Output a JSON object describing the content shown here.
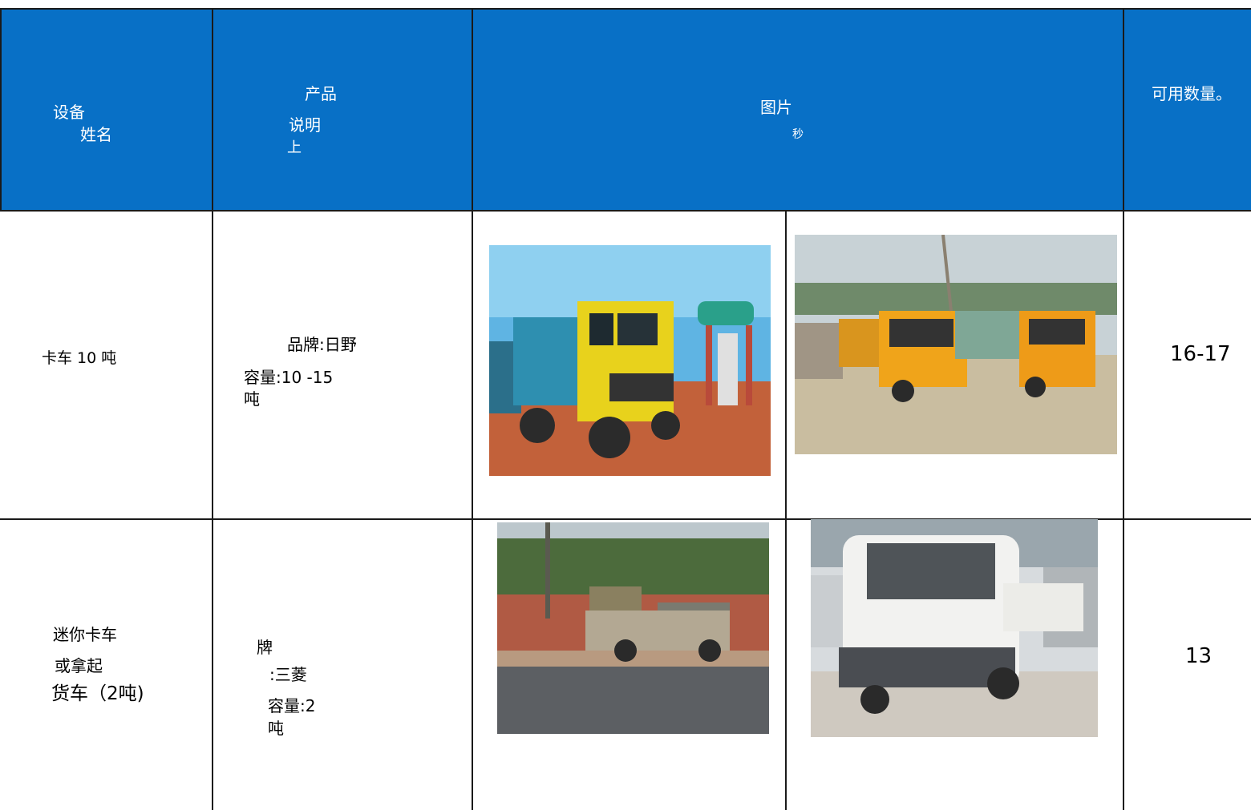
{
  "header": {
    "col1_line1": "设备",
    "col1_line2": "姓名",
    "col2_line1": "产品",
    "col2_line2": "说明",
    "col2_line3": "上",
    "col3_line1": "图片",
    "col3_line2": "秒",
    "col4": "可用数量。"
  },
  "rows": [
    {
      "name": "卡车 10 吨",
      "desc_line1": "品牌:日野",
      "desc_line2": "容量:10 -15",
      "desc_line3": "吨",
      "qty": "16-17",
      "photo1_icon": "yellow-truck-photo",
      "photo2_icon": "orange-trucks-fleet-photo"
    },
    {
      "name_line1": "迷你卡车",
      "name_line2": "或拿起",
      "name_line3": "货车（2吨)",
      "desc_line1": "牌",
      "desc_line2": ":三菱",
      "desc_line3": "容量:2",
      "desc_line4": "吨",
      "qty": "13",
      "photo1_icon": "pickup-truck-photo",
      "photo2_icon": "white-mini-truck-photo"
    }
  ],
  "colors": {
    "header_bg": "#0870c6",
    "header_text": "#ffffff",
    "grid": "#1a1a1a"
  }
}
